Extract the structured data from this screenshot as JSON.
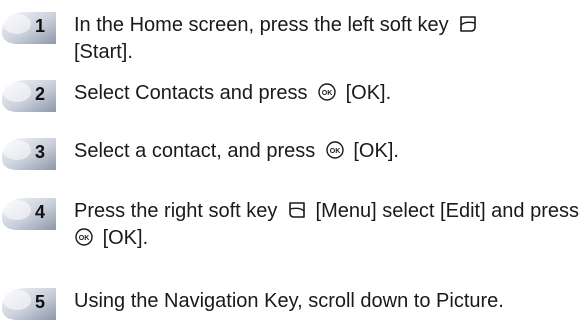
{
  "steps": [
    {
      "number": "1",
      "text_before": "In the Home screen, press the left soft key",
      "icon": "left-soft-key-icon",
      "text_after": "[Start]."
    },
    {
      "number": "2",
      "text_before": "Select Contacts and press",
      "icon": "ok-key-icon",
      "text_after": "[OK]."
    },
    {
      "number": "3",
      "text_before": "Select a contact, and press",
      "icon": "ok-key-icon",
      "text_after": "[OK]."
    },
    {
      "number": "4",
      "text_before": "Press the right soft key",
      "icon": "right-soft-key-icon",
      "text_middle": "[Menu] select [Edit] and press",
      "icon2": "ok-key-icon",
      "text_after": "[OK]."
    },
    {
      "number": "5",
      "text_before": "Using the Navigation Key, scroll down to Picture."
    }
  ],
  "colors": {
    "badge_light": "#eef1f6",
    "badge_dark": "#9aa3b3",
    "text": "#1a1a1a"
  }
}
